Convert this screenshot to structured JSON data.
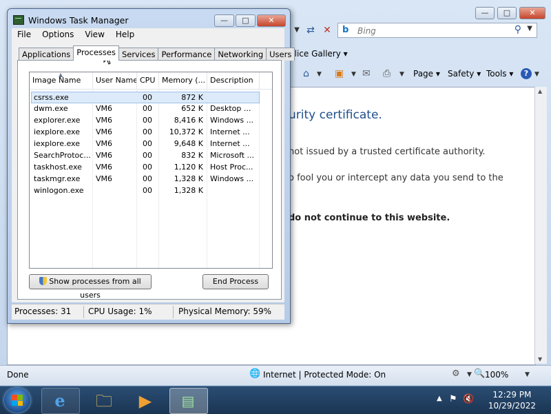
{
  "ie": {
    "search_placeholder": "Bing",
    "fav_slice": "Slice Gallery",
    "cmd_page": "Page",
    "cmd_safety": "Safety",
    "cmd_tools": "Tools",
    "content_title": "urity certificate.",
    "content_line1": "not issued by a trusted certificate authority.",
    "content_line2": "o fool you or intercept any data you send to the",
    "content_bold": "do not continue to this website.",
    "status_done": "Done",
    "status_zone": "Internet | Protected Mode: On",
    "status_zoom": "100%"
  },
  "taskmgr": {
    "title": "Windows Task Manager",
    "menu": [
      "File",
      "Options",
      "View",
      "Help"
    ],
    "tabs": [
      "Applications",
      "Processes",
      "Services",
      "Performance",
      "Networking",
      "Users"
    ],
    "active_tab": "Processes",
    "columns": [
      "Image Name",
      "User Name",
      "CPU",
      "Memory (...",
      "Description"
    ],
    "rows": [
      {
        "image": "csrss.exe",
        "user": "",
        "cpu": "00",
        "memory": "872 K",
        "desc": ""
      },
      {
        "image": "dwm.exe",
        "user": "VM6",
        "cpu": "00",
        "memory": "652 K",
        "desc": "Desktop ..."
      },
      {
        "image": "explorer.exe",
        "user": "VM6",
        "cpu": "00",
        "memory": "8,416 K",
        "desc": "Windows ..."
      },
      {
        "image": "iexplore.exe",
        "user": "VM6",
        "cpu": "00",
        "memory": "10,372 K",
        "desc": "Internet ..."
      },
      {
        "image": "iexplore.exe",
        "user": "VM6",
        "cpu": "00",
        "memory": "9,648 K",
        "desc": "Internet ..."
      },
      {
        "image": "SearchProtoc...",
        "user": "VM6",
        "cpu": "00",
        "memory": "832 K",
        "desc": "Microsoft ..."
      },
      {
        "image": "taskhost.exe",
        "user": "VM6",
        "cpu": "00",
        "memory": "1,120 K",
        "desc": "Host Proc..."
      },
      {
        "image": "taskmgr.exe",
        "user": "VM6",
        "cpu": "00",
        "memory": "1,328 K",
        "desc": "Windows ..."
      },
      {
        "image": "winlogon.exe",
        "user": "",
        "cpu": "00",
        "memory": "1,328 K",
        "desc": ""
      }
    ],
    "show_all_label": "Show processes from all users",
    "end_process_label": "End Process",
    "status": {
      "processes": "Processes: 31",
      "cpu": "CPU Usage: 1%",
      "memory": "Physical Memory: 59%"
    }
  },
  "taskbar": {
    "time": "12:29 PM",
    "date": "10/29/2022"
  }
}
